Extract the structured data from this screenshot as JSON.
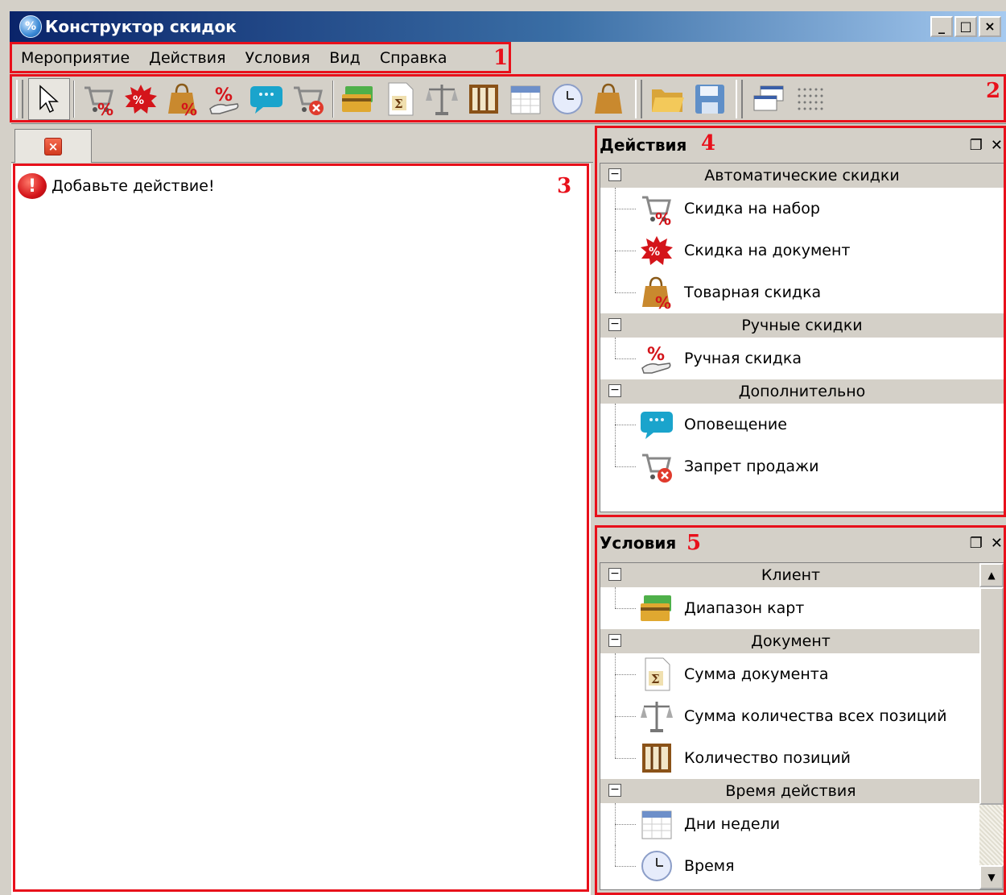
{
  "window": {
    "title": "Конструктор скидок",
    "controls": [
      "_",
      "□",
      "×"
    ]
  },
  "menu": {
    "items": [
      "Мероприятие",
      "Действия",
      "Условия",
      "Вид",
      "Справка"
    ]
  },
  "annotations": {
    "n1": "1",
    "n2": "2",
    "n3": "3",
    "n4": "4",
    "n5": "5"
  },
  "document": {
    "message": "Добавьте действие!"
  },
  "actions_panel": {
    "title": "Действия",
    "groups": [
      {
        "label": "Автоматические скидки",
        "items": [
          "Скидка на набор",
          "Скидка на документ",
          "Товарная скидка"
        ]
      },
      {
        "label": "Ручные скидки",
        "items": [
          "Ручная скидка"
        ]
      },
      {
        "label": "Дополнительно",
        "items": [
          "Оповещение",
          "Запрет продажи"
        ]
      }
    ]
  },
  "conditions_panel": {
    "title": "Условия",
    "groups": [
      {
        "label": "Клиент",
        "items": [
          "Диапазон карт"
        ]
      },
      {
        "label": "Документ",
        "items": [
          "Сумма документа",
          "Сумма количества всех позиций",
          "Количество позиций"
        ]
      },
      {
        "label": "Время действия",
        "items": [
          "Дни недели",
          "Время"
        ]
      }
    ]
  },
  "colors": {
    "annotation_red": "#e8101b",
    "titlebar_start": "#0a246a",
    "titlebar_end": "#a6caf0",
    "chrome": "#d4d0c8"
  }
}
